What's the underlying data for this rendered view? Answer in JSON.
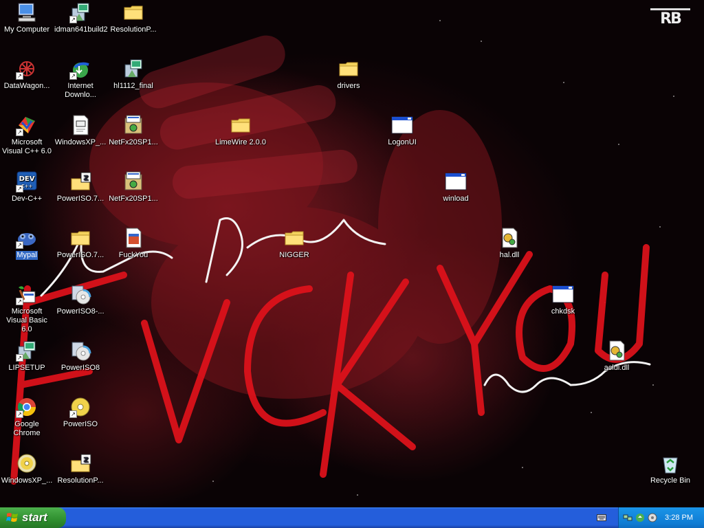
{
  "desktop": {
    "icons": [
      {
        "label": "My Computer",
        "icon": "my-computer-icon"
      },
      {
        "label": "idman641build2",
        "icon": "installer-icon"
      },
      {
        "label": "ResolutionP...",
        "icon": "folder-icon"
      },
      {
        "label": "DataWagon...",
        "icon": "datawagon-icon"
      },
      {
        "label": "Internet Downlo...",
        "icon": "internet-download-manager-icon"
      },
      {
        "label": "hl1112_final",
        "icon": "installer-icon"
      },
      {
        "label": "drivers",
        "icon": "folder-icon"
      },
      {
        "label": "Microsoft Visual C++ 6.0",
        "icon": "visual-cpp-icon"
      },
      {
        "label": "WindowsXP_...",
        "icon": "document-icon"
      },
      {
        "label": "NetFx20SP1...",
        "icon": "setup-icon"
      },
      {
        "label": "LimeWire 2.0.0",
        "icon": "folder-icon"
      },
      {
        "label": "LogonUI",
        "icon": "application-window-icon"
      },
      {
        "label": "Dev-C++",
        "icon": "dev-cpp-icon"
      },
      {
        "label": "PowerISO.7...",
        "icon": "zip-folder-icon"
      },
      {
        "label": "NetFx20SP1...",
        "icon": "setup-icon"
      },
      {
        "label": "winload",
        "icon": "application-window-icon"
      },
      {
        "label": "Mypal",
        "icon": "mypal-icon"
      },
      {
        "label": "PowerISO.7...",
        "icon": "folder-icon"
      },
      {
        "label": "FuckYou",
        "icon": "image-file-icon"
      },
      {
        "label": "NIGGER",
        "icon": "folder-icon"
      },
      {
        "label": "hal.dll",
        "icon": "dll-icon"
      },
      {
        "label": "Microsoft Visual Basic 6.0",
        "icon": "visual-basic-icon"
      },
      {
        "label": "PowerISO8-...",
        "icon": "poweriso-setup-icon"
      },
      {
        "label": "chkdsk",
        "icon": "application-window-icon"
      },
      {
        "label": "LIPSETUP",
        "icon": "installer-icon"
      },
      {
        "label": "PowerISO8",
        "icon": "poweriso-setup-icon"
      },
      {
        "label": "aclui.dll",
        "icon": "dll-icon"
      },
      {
        "label": "Google Chrome",
        "icon": "chrome-icon"
      },
      {
        "label": "PowerISO",
        "icon": "poweriso-disc-icon"
      },
      {
        "label": "WindowsXP_...",
        "icon": "disc-image-icon"
      },
      {
        "label": "ResolutionP...",
        "icon": "zip-folder-icon"
      },
      {
        "label": "Recycle Bin",
        "icon": "recycle-bin-icon"
      }
    ],
    "selected_icon": "Mypal"
  },
  "taskbar": {
    "start_label": "start",
    "clock": "3:28 PM"
  },
  "colors": {
    "taskbar": "#245edb",
    "start_button": "#2f8f2f",
    "tray": "#0f7bd3",
    "selection": "#3169c6",
    "wallpaper_text": "#e0121b"
  }
}
